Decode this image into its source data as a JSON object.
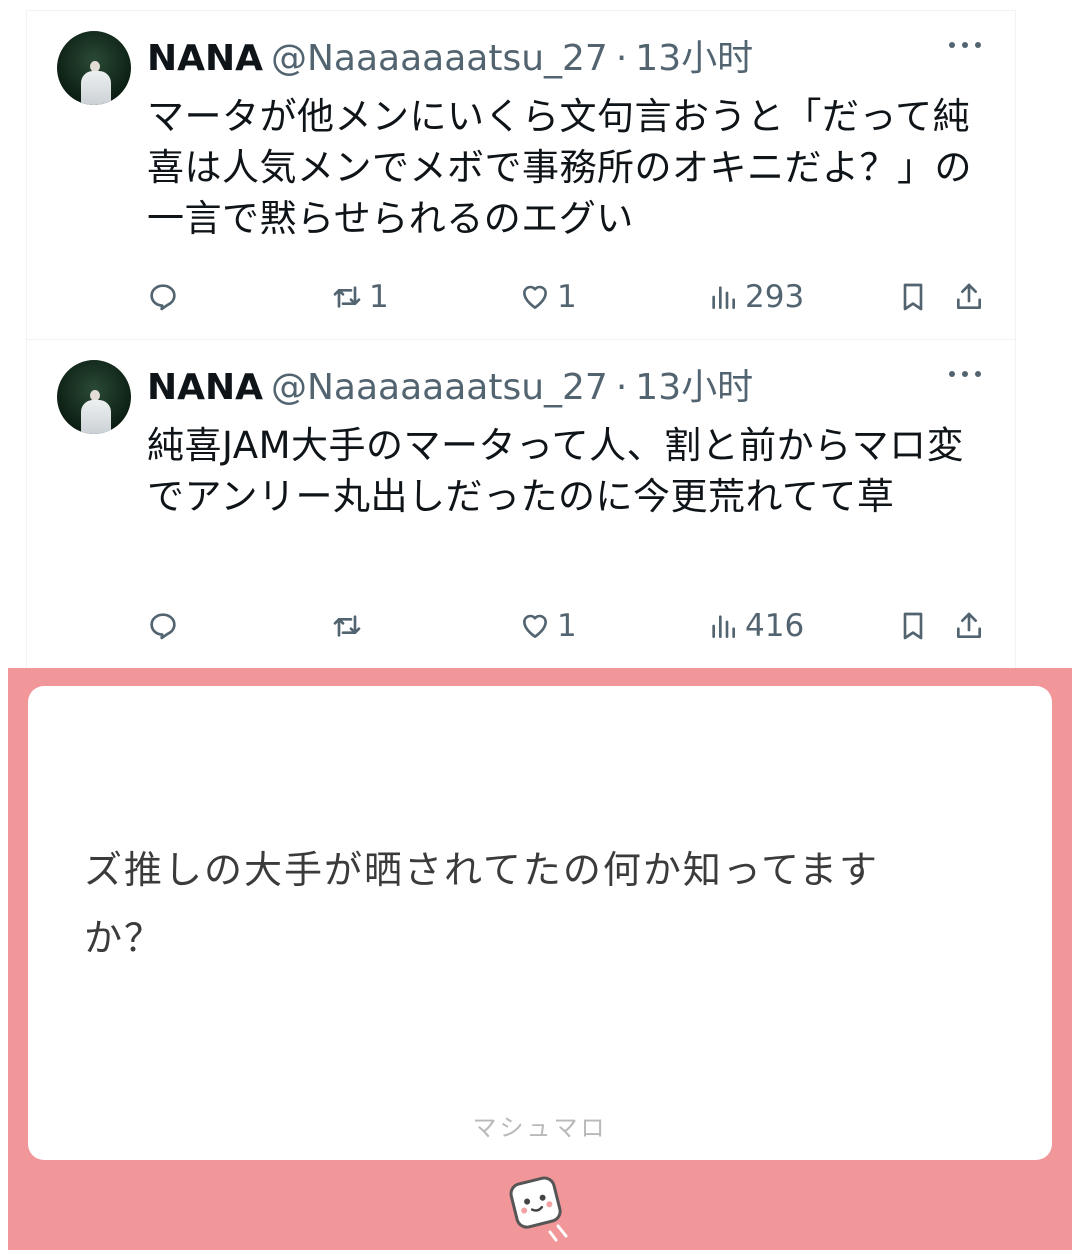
{
  "tweets": [
    {
      "display_name": "NANA",
      "handle": "@Naaaaaaatsu_27",
      "separator": "·",
      "time": "13小时",
      "text": "マータが他メンにいくら文句言おうと「だって純喜は人気メンでメボで事務所のオキニだよ？」の一言で黙らせられるのエグい",
      "replies": "",
      "retweets": "1",
      "likes": "1",
      "views": "293"
    },
    {
      "display_name": "NANA",
      "handle": "@Naaaaaaatsu_27",
      "separator": "·",
      "time": "13小时",
      "text": "純喜JAM大手のマータって人、割と前からマロ変でアンリー丸出しだったのに今更荒れてて草",
      "replies": "",
      "retweets": "",
      "likes": "1",
      "views": "416"
    }
  ],
  "marshmallow": {
    "question": "ズ推しの大手が晒されてたの何か知ってますか？",
    "brand": "マシュマロ"
  },
  "colors": {
    "marshmallow_bg": "#f19699",
    "muted_text": "#536471",
    "primary_text": "#0f1419"
  },
  "icons": [
    "reply-icon",
    "retweet-icon",
    "like-icon",
    "views-icon",
    "bookmark-icon",
    "share-icon",
    "more-icon",
    "marshmallow-logo"
  ]
}
